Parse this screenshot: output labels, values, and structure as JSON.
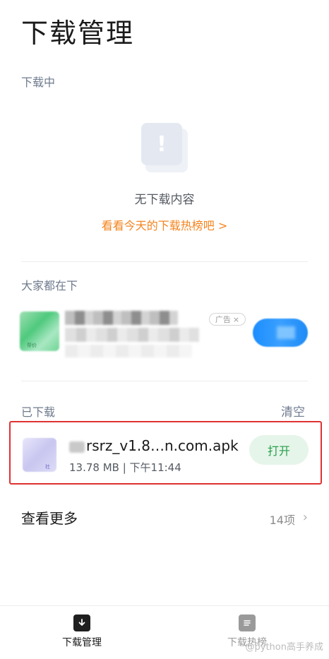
{
  "page": {
    "title": "下载管理"
  },
  "downloading": {
    "section_label": "下载中",
    "empty_text": "无下载内容",
    "empty_link": "看看今天的下载热榜吧 >"
  },
  "popular": {
    "section_label": "大家都在下",
    "app_badge": "帮价",
    "ad_badge": "广告",
    "ad_close": "×"
  },
  "downloaded": {
    "section_label": "已下载",
    "clear_label": "清空",
    "items": [
      {
        "icon_tag": "社",
        "name": "rsrz_v1.8…n.com.apk",
        "meta": "13.78 MB | 下午11:44",
        "action": "打开"
      }
    ]
  },
  "more": {
    "label": "查看更多",
    "count": "14项",
    "chevron": "›"
  },
  "tabs": [
    {
      "label": "下载管理",
      "icon": "download-icon",
      "active": true
    },
    {
      "label": "下载热榜",
      "icon": "list-icon",
      "active": false
    }
  ],
  "watermark": "@python高手养成",
  "colors": {
    "accent_orange": "#f5841f",
    "open_green": "#27a04a",
    "open_bg": "#e6f5ea",
    "highlight_red": "#e03131"
  }
}
